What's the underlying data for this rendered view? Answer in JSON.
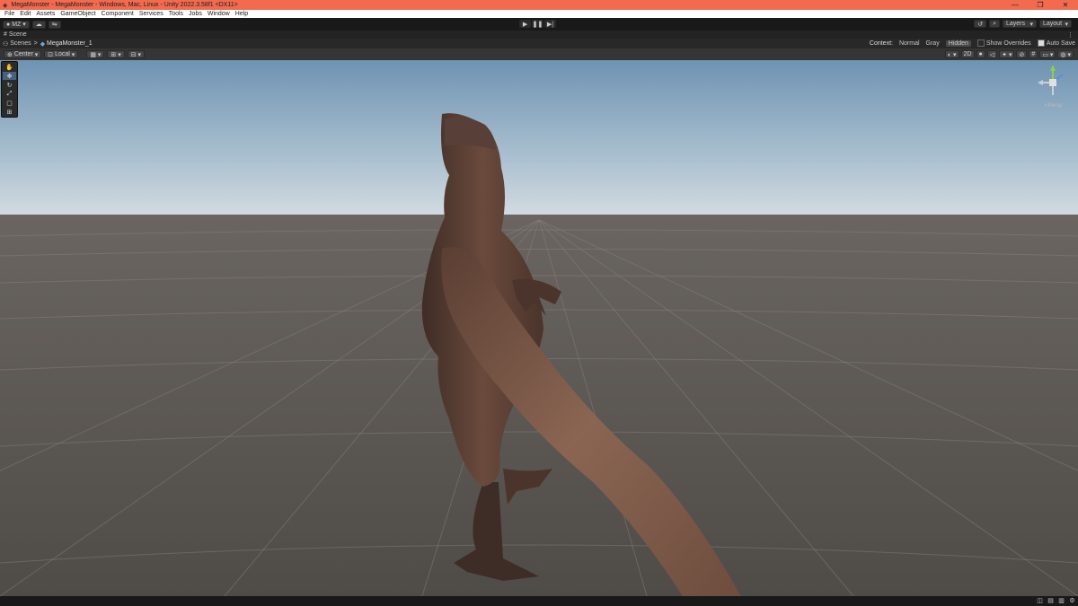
{
  "window": {
    "title": "MegaMonster - MegaMonster - Windows, Mac, Linux - Unity 2022.3.58f1 <DX11>"
  },
  "menu": [
    "File",
    "Edit",
    "Assets",
    "GameObject",
    "Component",
    "Services",
    "Tools",
    "Jobs",
    "Window",
    "Help"
  ],
  "toolbar": {
    "account": "MZ",
    "layers": "Layers",
    "layout": "Layout"
  },
  "tab": {
    "label": "Scene"
  },
  "breadcrumb": {
    "root": "Scenes",
    "separator": ">",
    "current": "MegaMonster_1"
  },
  "context": {
    "label": "Context:",
    "options": [
      "Normal",
      "Gray",
      "Hidden"
    ],
    "selected": "Hidden",
    "show_overrides": "Show Overrides",
    "auto_save": "Auto Save"
  },
  "scene_tools": {
    "pivot": "Center",
    "space": "Local",
    "mode_2d": "2D"
  },
  "gizmo": {
    "projection": "≺Persp"
  },
  "colors": {
    "title_bar": "#f26b4f",
    "accent": "#4a6fa5"
  }
}
